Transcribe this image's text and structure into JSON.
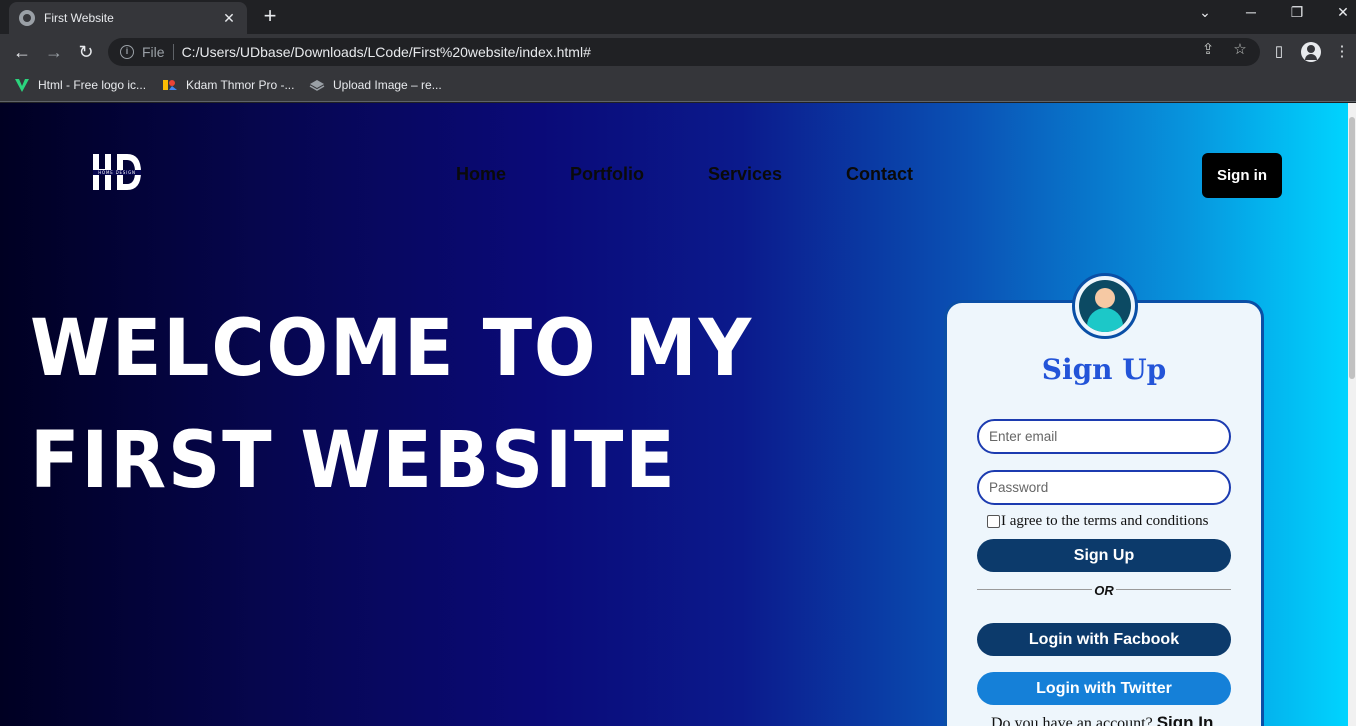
{
  "browser": {
    "tab_title": "First Website",
    "address_prefix": "File",
    "url": "C:/Users/UDbase/Downloads/LCode/First%20website/index.html#",
    "bookmarks": [
      {
        "label": "Html - Free logo ic...",
        "icon": "vector-v-icon"
      },
      {
        "label": "Kdam Thmor Pro -...",
        "icon": "google-fonts-icon"
      },
      {
        "label": "Upload Image – re...",
        "icon": "layers-icon"
      }
    ]
  },
  "page": {
    "nav": {
      "items": [
        "Home",
        "Portfolio",
        "Services",
        "Contact"
      ],
      "signin_label": "Sign in"
    },
    "hero": {
      "line1": "WELCOME TO MY",
      "line2": "FIRST WEBSITE"
    },
    "form": {
      "title": "Sign Up",
      "email_placeholder": "Enter email",
      "password_placeholder": "Password",
      "agree_label": "I agree to the terms and conditions",
      "signup_label": "Sign Up",
      "or_label": "OR",
      "facebook_label": "Login with Facbook",
      "twitter_label": "Login with Twitter",
      "have_account": "Do you have an account?",
      "signin_link": "Sign In"
    },
    "colors": {
      "card_border": "#0a4fa6",
      "title_blue": "#2354d8",
      "dark_button": "#0c3a6b",
      "twitter_button": "#1580d8"
    }
  }
}
